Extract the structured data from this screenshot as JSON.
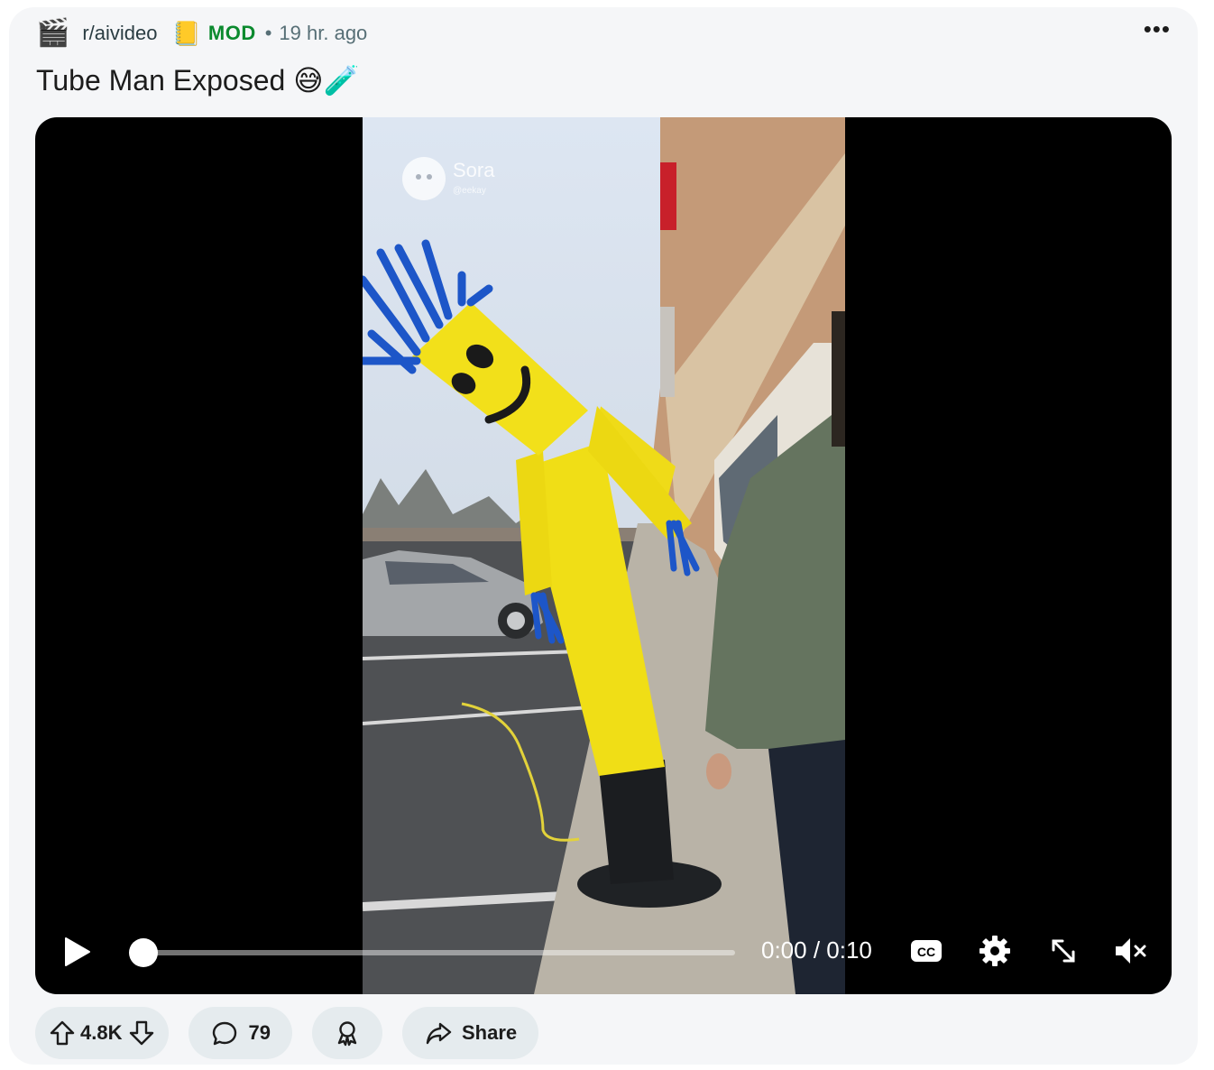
{
  "post": {
    "subreddit": "r/aivideo",
    "subreddit_icon": "clapperboard-icon",
    "flair_icon": "notebook-icon",
    "flair": "MOD",
    "separator": "•",
    "time": "19 hr. ago",
    "title": "Tube Man Exposed 😅🧪",
    "more_label": "•••"
  },
  "video": {
    "watermark_brand": "Sora",
    "watermark_handle": "@eekay",
    "current_time": "0:00",
    "duration": "0:10",
    "time_display": "0:00 / 0:10",
    "progress_fraction": 0,
    "muted": true
  },
  "actions": {
    "score": "4.8K",
    "comments": "79",
    "share_label": "Share"
  },
  "colors": {
    "card_bg": "#f5f6f8",
    "pill_bg": "#e5ebee",
    "mod_green": "#0b8a2e",
    "muted_text": "#576f76"
  }
}
